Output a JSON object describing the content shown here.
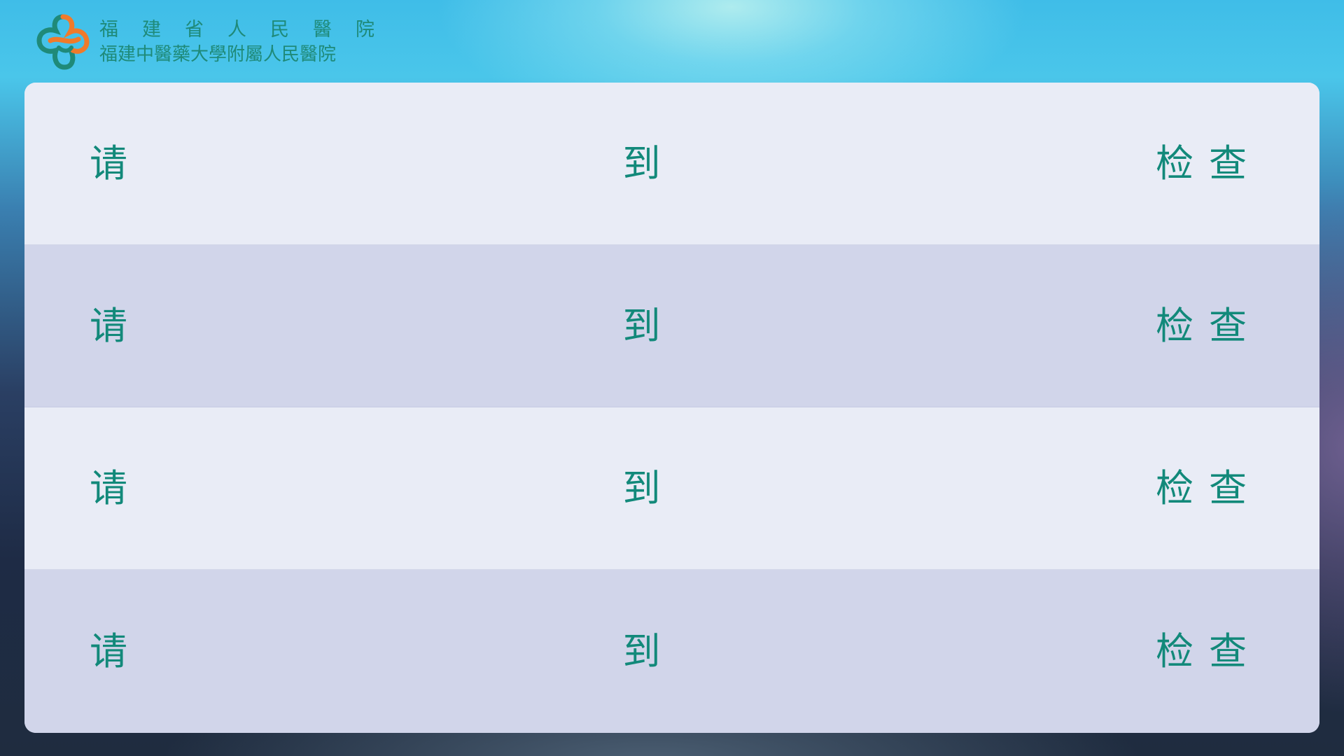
{
  "header": {
    "logo_line1": "福建省人民醫院",
    "logo_line2": "福建中醫藥大學附屬人民醫院"
  },
  "rows": [
    {
      "left": "请",
      "middle": "到",
      "right": "检查"
    },
    {
      "left": "请",
      "middle": "到",
      "right": "检查"
    },
    {
      "left": "请",
      "middle": "到",
      "right": "检查"
    },
    {
      "left": "请",
      "middle": "到",
      "right": "检查"
    }
  ],
  "colors": {
    "text_accent": "#12897a",
    "row_light": "#e9ecf6",
    "row_dark": "#d1d5ea",
    "logo_orange": "#f07a2a",
    "logo_teal": "#1f8a79"
  },
  "icons": {
    "hospital_logo": "hospital-cross-logo-icon"
  }
}
